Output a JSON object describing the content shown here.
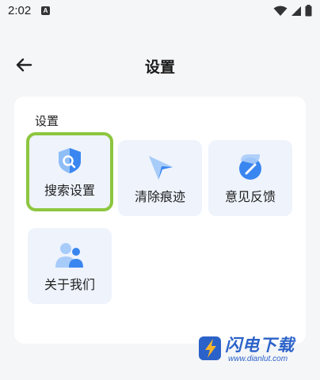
{
  "status_bar": {
    "time": "2:02",
    "notification_letter": "A"
  },
  "header": {
    "title": "设置"
  },
  "section": {
    "title": "设置",
    "tiles": [
      {
        "label": "搜索设置",
        "icon": "search-settings-icon",
        "selected": true
      },
      {
        "label": "清除痕迹",
        "icon": "clear-history-icon",
        "selected": false
      },
      {
        "label": "意见反馈",
        "icon": "feedback-icon",
        "selected": false
      },
      {
        "label": "关于我们",
        "icon": "about-us-icon",
        "selected": false
      }
    ]
  },
  "watermark": {
    "brand": "闪电下载",
    "url": "www.dianlut.com"
  },
  "colors": {
    "accent": "#3a86f0",
    "highlight": "#8dc63f",
    "tile_bg": "#eef3fc"
  }
}
